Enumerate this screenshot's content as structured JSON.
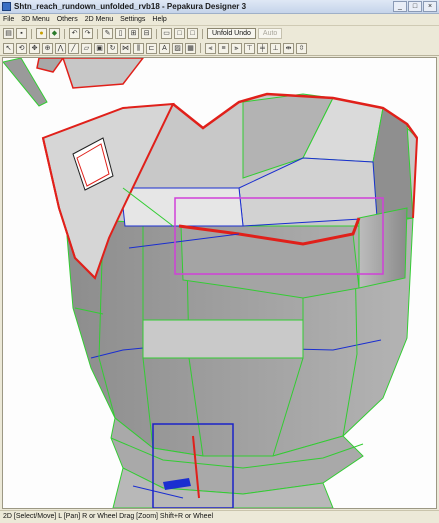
{
  "window": {
    "title": "Shtn_reach_rundown_unfolded_rvb18 - Pepakura Designer 3",
    "controls": [
      "_",
      "□",
      "×"
    ]
  },
  "menu": [
    "File",
    "3D Menu",
    "Others",
    "2D Menu",
    "Settings",
    "Help"
  ],
  "toolbar": {
    "row1_icons": [
      "open-icon",
      "save-icon",
      "light-bulb-icon",
      "texture-icon",
      "undo-icon",
      "redo-icon",
      "pencil-icon",
      "spray-icon",
      "join-edges-icon",
      "disconnect-icon",
      "print-icon",
      "view-3d-icon",
      "view-2d-icon",
      "view-split-icon"
    ],
    "unfold_undo_label": "Unfold Undo",
    "auto_label": "Auto",
    "row2_icons": [
      "select-icon",
      "rotate-icon",
      "pan-icon",
      "zoom-icon",
      "fold-icon",
      "edge-icon",
      "flap-icon",
      "move-part-icon",
      "rotate-part-icon",
      "join-icon",
      "split-icon",
      "add-flap-icon",
      "text-icon",
      "image-icon",
      "layout-icon",
      "align-left-icon",
      "align-center-icon",
      "align-right-icon",
      "align-top-icon",
      "align-middle-icon",
      "align-bottom-icon",
      "distribute-h-icon",
      "distribute-v-icon"
    ]
  },
  "status_text": "2D [Select/Move] L [Pan] R or Wheel Drag [Zoom] Shift+R or Wheel",
  "colors": {
    "cut_edge": "#e0201a",
    "fold_edge": "#33cc33",
    "valley_edge": "#1a2ed0",
    "highlight_magenta": "#d040d8",
    "highlight_blue": "#1a22c8",
    "face_mid": "#a6a6a6"
  }
}
